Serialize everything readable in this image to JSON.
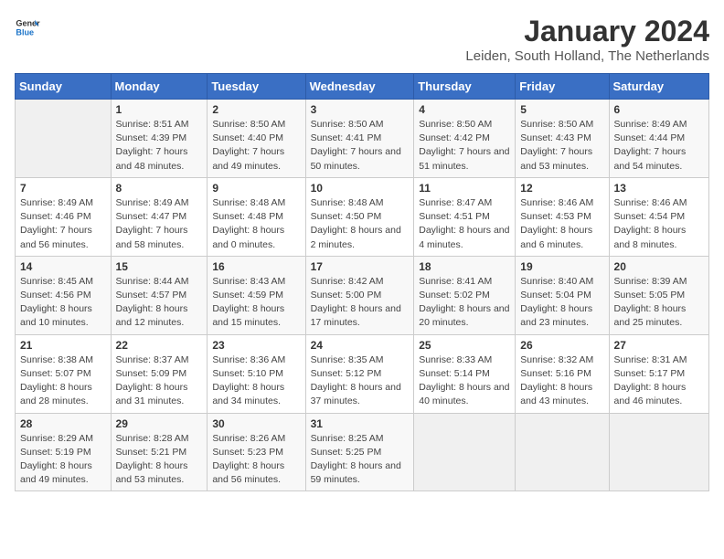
{
  "header": {
    "logo_line1": "General",
    "logo_line2": "Blue",
    "title": "January 2024",
    "subtitle": "Leiden, South Holland, The Netherlands"
  },
  "days_of_week": [
    "Sunday",
    "Monday",
    "Tuesday",
    "Wednesday",
    "Thursday",
    "Friday",
    "Saturday"
  ],
  "weeks": [
    [
      {
        "day": "",
        "sunrise": "",
        "sunset": "",
        "daylight": ""
      },
      {
        "day": "1",
        "sunrise": "Sunrise: 8:51 AM",
        "sunset": "Sunset: 4:39 PM",
        "daylight": "Daylight: 7 hours and 48 minutes."
      },
      {
        "day": "2",
        "sunrise": "Sunrise: 8:50 AM",
        "sunset": "Sunset: 4:40 PM",
        "daylight": "Daylight: 7 hours and 49 minutes."
      },
      {
        "day": "3",
        "sunrise": "Sunrise: 8:50 AM",
        "sunset": "Sunset: 4:41 PM",
        "daylight": "Daylight: 7 hours and 50 minutes."
      },
      {
        "day": "4",
        "sunrise": "Sunrise: 8:50 AM",
        "sunset": "Sunset: 4:42 PM",
        "daylight": "Daylight: 7 hours and 51 minutes."
      },
      {
        "day": "5",
        "sunrise": "Sunrise: 8:50 AM",
        "sunset": "Sunset: 4:43 PM",
        "daylight": "Daylight: 7 hours and 53 minutes."
      },
      {
        "day": "6",
        "sunrise": "Sunrise: 8:49 AM",
        "sunset": "Sunset: 4:44 PM",
        "daylight": "Daylight: 7 hours and 54 minutes."
      }
    ],
    [
      {
        "day": "7",
        "sunrise": "Sunrise: 8:49 AM",
        "sunset": "Sunset: 4:46 PM",
        "daylight": "Daylight: 7 hours and 56 minutes."
      },
      {
        "day": "8",
        "sunrise": "Sunrise: 8:49 AM",
        "sunset": "Sunset: 4:47 PM",
        "daylight": "Daylight: 7 hours and 58 minutes."
      },
      {
        "day": "9",
        "sunrise": "Sunrise: 8:48 AM",
        "sunset": "Sunset: 4:48 PM",
        "daylight": "Daylight: 8 hours and 0 minutes."
      },
      {
        "day": "10",
        "sunrise": "Sunrise: 8:48 AM",
        "sunset": "Sunset: 4:50 PM",
        "daylight": "Daylight: 8 hours and 2 minutes."
      },
      {
        "day": "11",
        "sunrise": "Sunrise: 8:47 AM",
        "sunset": "Sunset: 4:51 PM",
        "daylight": "Daylight: 8 hours and 4 minutes."
      },
      {
        "day": "12",
        "sunrise": "Sunrise: 8:46 AM",
        "sunset": "Sunset: 4:53 PM",
        "daylight": "Daylight: 8 hours and 6 minutes."
      },
      {
        "day": "13",
        "sunrise": "Sunrise: 8:46 AM",
        "sunset": "Sunset: 4:54 PM",
        "daylight": "Daylight: 8 hours and 8 minutes."
      }
    ],
    [
      {
        "day": "14",
        "sunrise": "Sunrise: 8:45 AM",
        "sunset": "Sunset: 4:56 PM",
        "daylight": "Daylight: 8 hours and 10 minutes."
      },
      {
        "day": "15",
        "sunrise": "Sunrise: 8:44 AM",
        "sunset": "Sunset: 4:57 PM",
        "daylight": "Daylight: 8 hours and 12 minutes."
      },
      {
        "day": "16",
        "sunrise": "Sunrise: 8:43 AM",
        "sunset": "Sunset: 4:59 PM",
        "daylight": "Daylight: 8 hours and 15 minutes."
      },
      {
        "day": "17",
        "sunrise": "Sunrise: 8:42 AM",
        "sunset": "Sunset: 5:00 PM",
        "daylight": "Daylight: 8 hours and 17 minutes."
      },
      {
        "day": "18",
        "sunrise": "Sunrise: 8:41 AM",
        "sunset": "Sunset: 5:02 PM",
        "daylight": "Daylight: 8 hours and 20 minutes."
      },
      {
        "day": "19",
        "sunrise": "Sunrise: 8:40 AM",
        "sunset": "Sunset: 5:04 PM",
        "daylight": "Daylight: 8 hours and 23 minutes."
      },
      {
        "day": "20",
        "sunrise": "Sunrise: 8:39 AM",
        "sunset": "Sunset: 5:05 PM",
        "daylight": "Daylight: 8 hours and 25 minutes."
      }
    ],
    [
      {
        "day": "21",
        "sunrise": "Sunrise: 8:38 AM",
        "sunset": "Sunset: 5:07 PM",
        "daylight": "Daylight: 8 hours and 28 minutes."
      },
      {
        "day": "22",
        "sunrise": "Sunrise: 8:37 AM",
        "sunset": "Sunset: 5:09 PM",
        "daylight": "Daylight: 8 hours and 31 minutes."
      },
      {
        "day": "23",
        "sunrise": "Sunrise: 8:36 AM",
        "sunset": "Sunset: 5:10 PM",
        "daylight": "Daylight: 8 hours and 34 minutes."
      },
      {
        "day": "24",
        "sunrise": "Sunrise: 8:35 AM",
        "sunset": "Sunset: 5:12 PM",
        "daylight": "Daylight: 8 hours and 37 minutes."
      },
      {
        "day": "25",
        "sunrise": "Sunrise: 8:33 AM",
        "sunset": "Sunset: 5:14 PM",
        "daylight": "Daylight: 8 hours and 40 minutes."
      },
      {
        "day": "26",
        "sunrise": "Sunrise: 8:32 AM",
        "sunset": "Sunset: 5:16 PM",
        "daylight": "Daylight: 8 hours and 43 minutes."
      },
      {
        "day": "27",
        "sunrise": "Sunrise: 8:31 AM",
        "sunset": "Sunset: 5:17 PM",
        "daylight": "Daylight: 8 hours and 46 minutes."
      }
    ],
    [
      {
        "day": "28",
        "sunrise": "Sunrise: 8:29 AM",
        "sunset": "Sunset: 5:19 PM",
        "daylight": "Daylight: 8 hours and 49 minutes."
      },
      {
        "day": "29",
        "sunrise": "Sunrise: 8:28 AM",
        "sunset": "Sunset: 5:21 PM",
        "daylight": "Daylight: 8 hours and 53 minutes."
      },
      {
        "day": "30",
        "sunrise": "Sunrise: 8:26 AM",
        "sunset": "Sunset: 5:23 PM",
        "daylight": "Daylight: 8 hours and 56 minutes."
      },
      {
        "day": "31",
        "sunrise": "Sunrise: 8:25 AM",
        "sunset": "Sunset: 5:25 PM",
        "daylight": "Daylight: 8 hours and 59 minutes."
      },
      {
        "day": "",
        "sunrise": "",
        "sunset": "",
        "daylight": ""
      },
      {
        "day": "",
        "sunrise": "",
        "sunset": "",
        "daylight": ""
      },
      {
        "day": "",
        "sunrise": "",
        "sunset": "",
        "daylight": ""
      }
    ]
  ]
}
